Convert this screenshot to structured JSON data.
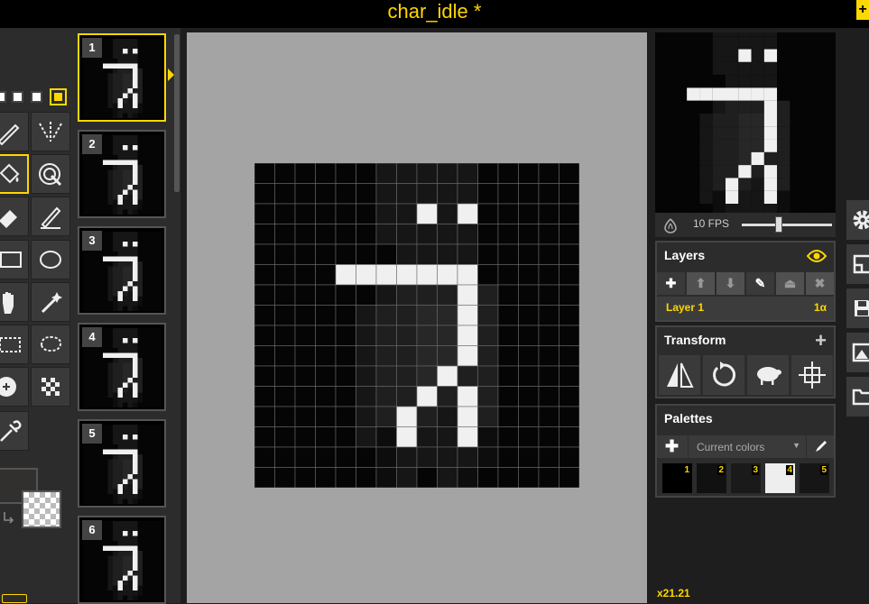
{
  "app": {
    "title": "char_idle *"
  },
  "tools": {
    "pen_sizes": [
      {
        "id": "size-1",
        "active": false
      },
      {
        "id": "size-2",
        "active": false
      },
      {
        "id": "size-3",
        "active": false
      },
      {
        "id": "size-4",
        "active": false
      },
      {
        "id": "size-5",
        "active": true
      }
    ],
    "items": [
      {
        "icon": "pen-icon",
        "active": false
      },
      {
        "icon": "vertical-mirror-pen-icon",
        "active": false
      },
      {
        "icon": "paint-bucket-icon",
        "active": true
      },
      {
        "icon": "paint-all-same-color-icon",
        "active": false
      },
      {
        "icon": "eraser-icon",
        "active": false
      },
      {
        "icon": "stroke-icon",
        "active": false
      },
      {
        "icon": "rectangle-icon",
        "active": false
      },
      {
        "icon": "circle-icon",
        "active": false
      },
      {
        "icon": "move-hand-icon",
        "active": false
      },
      {
        "icon": "shape-select-wand-icon",
        "active": false
      },
      {
        "icon": "rectangle-select-icon",
        "active": false
      },
      {
        "icon": "lasso-select-icon",
        "active": false
      },
      {
        "icon": "lighten-icon",
        "active": false
      },
      {
        "icon": "dithering-icon",
        "active": false
      },
      {
        "icon": "color-picker-icon",
        "active": false
      }
    ],
    "primary_color": "#322f2f",
    "secondary_color": "transparent"
  },
  "frames": [
    {
      "number": "1",
      "active": true
    },
    {
      "number": "2",
      "active": false
    },
    {
      "number": "3",
      "active": false
    },
    {
      "number": "4",
      "active": false
    },
    {
      "number": "5",
      "active": false
    },
    {
      "number": "6",
      "active": false
    }
  ],
  "preview": {
    "fps_label": "10 FPS",
    "fps_value": 10
  },
  "layers": {
    "title": "Layers",
    "items": [
      {
        "name": "Layer 1",
        "opacity": "1α"
      }
    ]
  },
  "transform": {
    "title": "Transform",
    "buttons": [
      "flip-icon",
      "rotate-icon",
      "clone-sheep-icon",
      "align-center-icon"
    ]
  },
  "palettes": {
    "title": "Palettes",
    "selected": "Current colors",
    "swatches": [
      {
        "number": "1",
        "color": "#000000"
      },
      {
        "number": "2",
        "color": "#111111"
      },
      {
        "number": "3",
        "color": "#1a1a1a"
      },
      {
        "number": "4",
        "color": "#eeeeee"
      },
      {
        "number": "5",
        "color": "#161616"
      }
    ]
  },
  "status": {
    "zoom": "x21.21"
  },
  "sprite": {
    "width": 16,
    "height": 16,
    "palette": {
      "0": "#050505",
      "1": "#0d0d0d",
      "2": "#161616",
      "3": "#1f1f1f",
      "4": "#272727",
      "5": "#f0f0f0"
    },
    "rows": [
      "0000002222200000",
      "0000002222200000",
      "0000002252500000",
      "0000002222200000",
      "0000000222200000",
      "0000555555500000",
      "0000002333530000",
      "0000023344530000",
      "0000023344530000",
      "0000023344530000",
      "0000023345330000",
      "0000023353530000",
      "0000023532530000",
      "0000021522510000",
      "0000001222210000",
      "0000001202100000"
    ]
  }
}
